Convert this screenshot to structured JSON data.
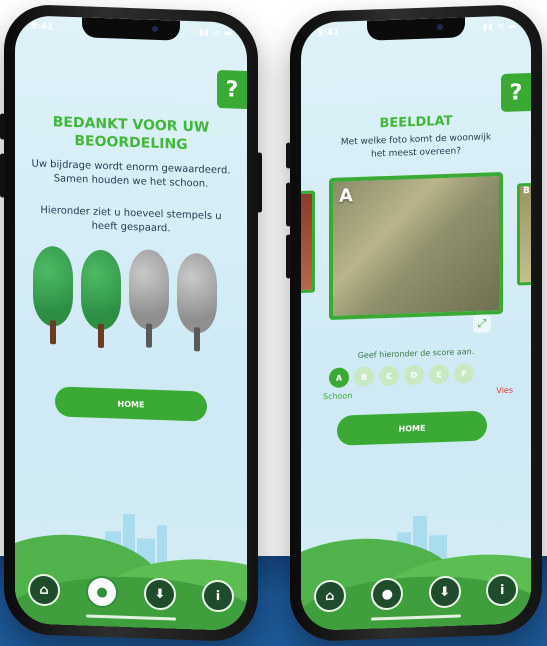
{
  "status_bar": {
    "time": "9:41",
    "icons": "▮▮ ≋ ▬"
  },
  "left_screen": {
    "help_label": "?",
    "title_line1": "BEDANKT VOOR UW",
    "title_line2": "BEOORDELING",
    "body_line1": "Uw bijdrage wordt enorm gewaardeerd.",
    "body_line2": "Samen houden we het schoon.",
    "stamps_line1": "Hieronder ziet u hoeveel stempels u",
    "stamps_line2": "heeft gespaard.",
    "stamps": {
      "earned": 2,
      "total": 4
    },
    "home_button": "HOME",
    "nav": [
      {
        "icon": "home-icon",
        "glyph": "⌂"
      },
      {
        "icon": "user-icon",
        "glyph": "●"
      },
      {
        "icon": "download-icon",
        "glyph": "⬇"
      },
      {
        "icon": "info-icon",
        "glyph": "i"
      }
    ]
  },
  "right_screen": {
    "help_label": "?",
    "title": "BEELDLAT",
    "question_line1": "Met welke foto komt de woonwijk",
    "question_line2": "het meest overeen?",
    "photo_letter": "A",
    "next_photo_letter": "B",
    "score_prompt": "Geef hieronder de score aan.",
    "scores": [
      "A",
      "B",
      "C",
      "D",
      "E",
      "F"
    ],
    "selected_score": "A",
    "label_clean": "Schoon",
    "label_dirty": "Vies",
    "home_button": "HOME",
    "nav": [
      {
        "icon": "home-icon",
        "glyph": "⌂"
      },
      {
        "icon": "user-icon",
        "glyph": "●"
      },
      {
        "icon": "download-icon",
        "glyph": "⬇"
      },
      {
        "icon": "info-icon",
        "glyph": "i"
      }
    ]
  },
  "colors": {
    "accent": "#3aaa35",
    "band": "#1d5a9b",
    "dirty": "#d9372f"
  }
}
